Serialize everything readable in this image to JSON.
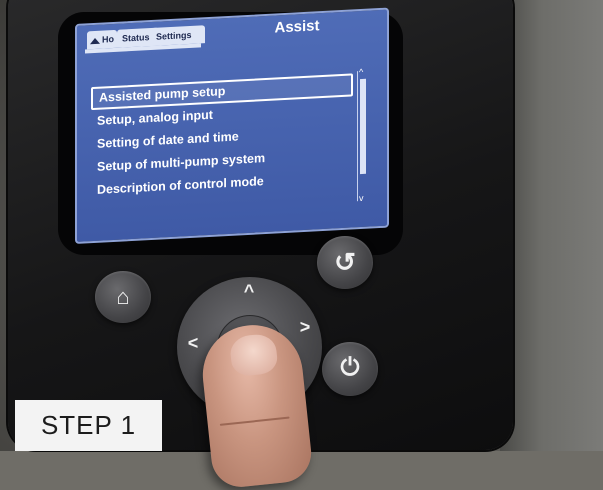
{
  "screen": {
    "tabs": [
      {
        "label": "Ho"
      },
      {
        "label": "Status"
      },
      {
        "label": "Settings"
      }
    ],
    "active_tab": "Assist",
    "menu_items": [
      "Assisted pump setup",
      "Setup, analog input",
      "Setting of date and time",
      "Setup of multi-pump system",
      "Description of control mode"
    ],
    "selected_index": 0
  },
  "caption": {
    "label": "STEP 1"
  },
  "colors": {
    "screen_bg": "#3f5aa6",
    "text": "#ffffff"
  }
}
